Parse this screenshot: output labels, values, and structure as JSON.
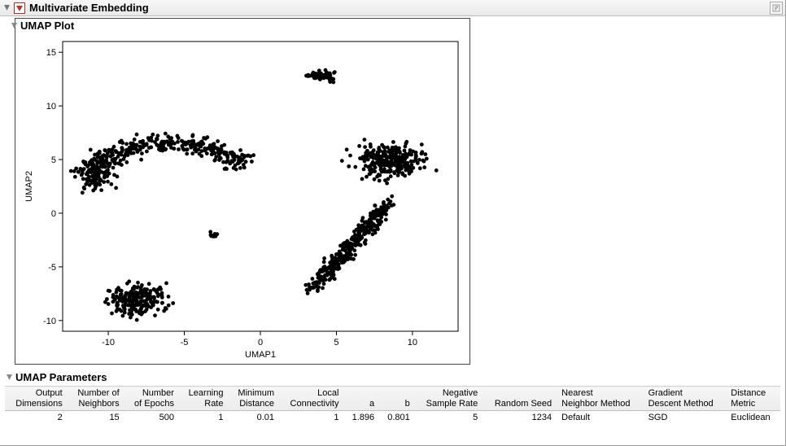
{
  "main_title": "Multivariate Embedding",
  "plot_section_title": "UMAP Plot",
  "params_section_title": "UMAP Parameters",
  "param_headers": [
    "Output\nDimensions",
    "Number of\nNeighbors",
    "Number\nof Epochs",
    "Learning\nRate",
    "Minimum\nDistance",
    "Local\nConnectivity",
    "a",
    "b",
    "Negative\nSample Rate",
    "Random Seed",
    "Nearest\nNeighbor Method",
    "Gradient\nDescent Method",
    "Distance\nMetric"
  ],
  "param_values": {
    "output_dimensions": "2",
    "number_of_neighbors": "15",
    "number_of_epochs": "500",
    "learning_rate": "1",
    "minimum_distance": "0.01",
    "local_connectivity": "1",
    "a": "1.896",
    "b": "0.801",
    "negative_sample_rate": "5",
    "random_seed": "1234",
    "nearest_neighbor_method": "Default",
    "gradient_descent_method": "SGD",
    "distance_metric": "Euclidean"
  },
  "chart_data": {
    "type": "scatter",
    "title": "",
    "xlabel": "UMAP1",
    "ylabel": "UMAP2",
    "xlim": [
      -13,
      13
    ],
    "ylim": [
      -11,
      16
    ],
    "xticks": [
      -10,
      -5,
      0,
      5,
      10
    ],
    "yticks": [
      -10,
      -5,
      0,
      5,
      10,
      15
    ],
    "clusters": [
      {
        "shape": "arc",
        "cx": -6,
        "cy": 3.5,
        "rx": 5.0,
        "ry": 3.0,
        "start": 20,
        "end": 200,
        "band": 2.6,
        "n": 420
      },
      {
        "shape": "blob",
        "cx": -8,
        "cy": -8,
        "rx": 2.0,
        "ry": 1.4,
        "n": 220
      },
      {
        "shape": "blob",
        "cx": 4,
        "cy": 12.8,
        "rx": 0.9,
        "ry": 0.5,
        "n": 70
      },
      {
        "shape": "diag",
        "x1": 3.5,
        "y1": -7,
        "x2": 8.5,
        "y2": 1,
        "band": 1.6,
        "n": 320
      },
      {
        "shape": "blob",
        "cx": 8.5,
        "cy": 5,
        "rx": 2.3,
        "ry": 1.6,
        "n": 260
      },
      {
        "shape": "blob",
        "cx": -3,
        "cy": -2,
        "rx": 0.4,
        "ry": 0.25,
        "n": 10
      }
    ]
  }
}
